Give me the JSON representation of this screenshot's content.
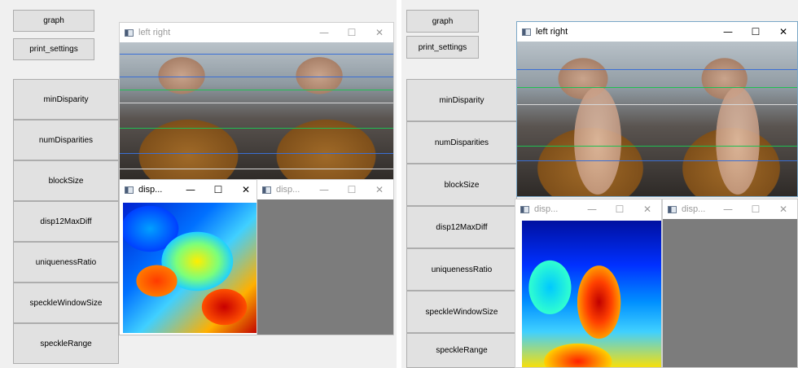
{
  "buttons": {
    "graph": "graph",
    "print_settings": "print_settings"
  },
  "trackbars": [
    "minDisparity",
    "numDisparities",
    "blockSize",
    "disp12MaxDiff",
    "uniquenessRatio",
    "speckleWindowSize",
    "speckleRange"
  ],
  "windows": {
    "left_right_title": "left right",
    "disparity_title": "disp...",
    "controls": {
      "minimize": "—",
      "maximize": "☐",
      "close": "✕"
    }
  },
  "colors": {
    "scanline_blue": "#3a6fd6",
    "scanline_green": "#1fbf52",
    "scanline_white": "#d8d8d8",
    "window_active_border": "#7aa7c7"
  }
}
